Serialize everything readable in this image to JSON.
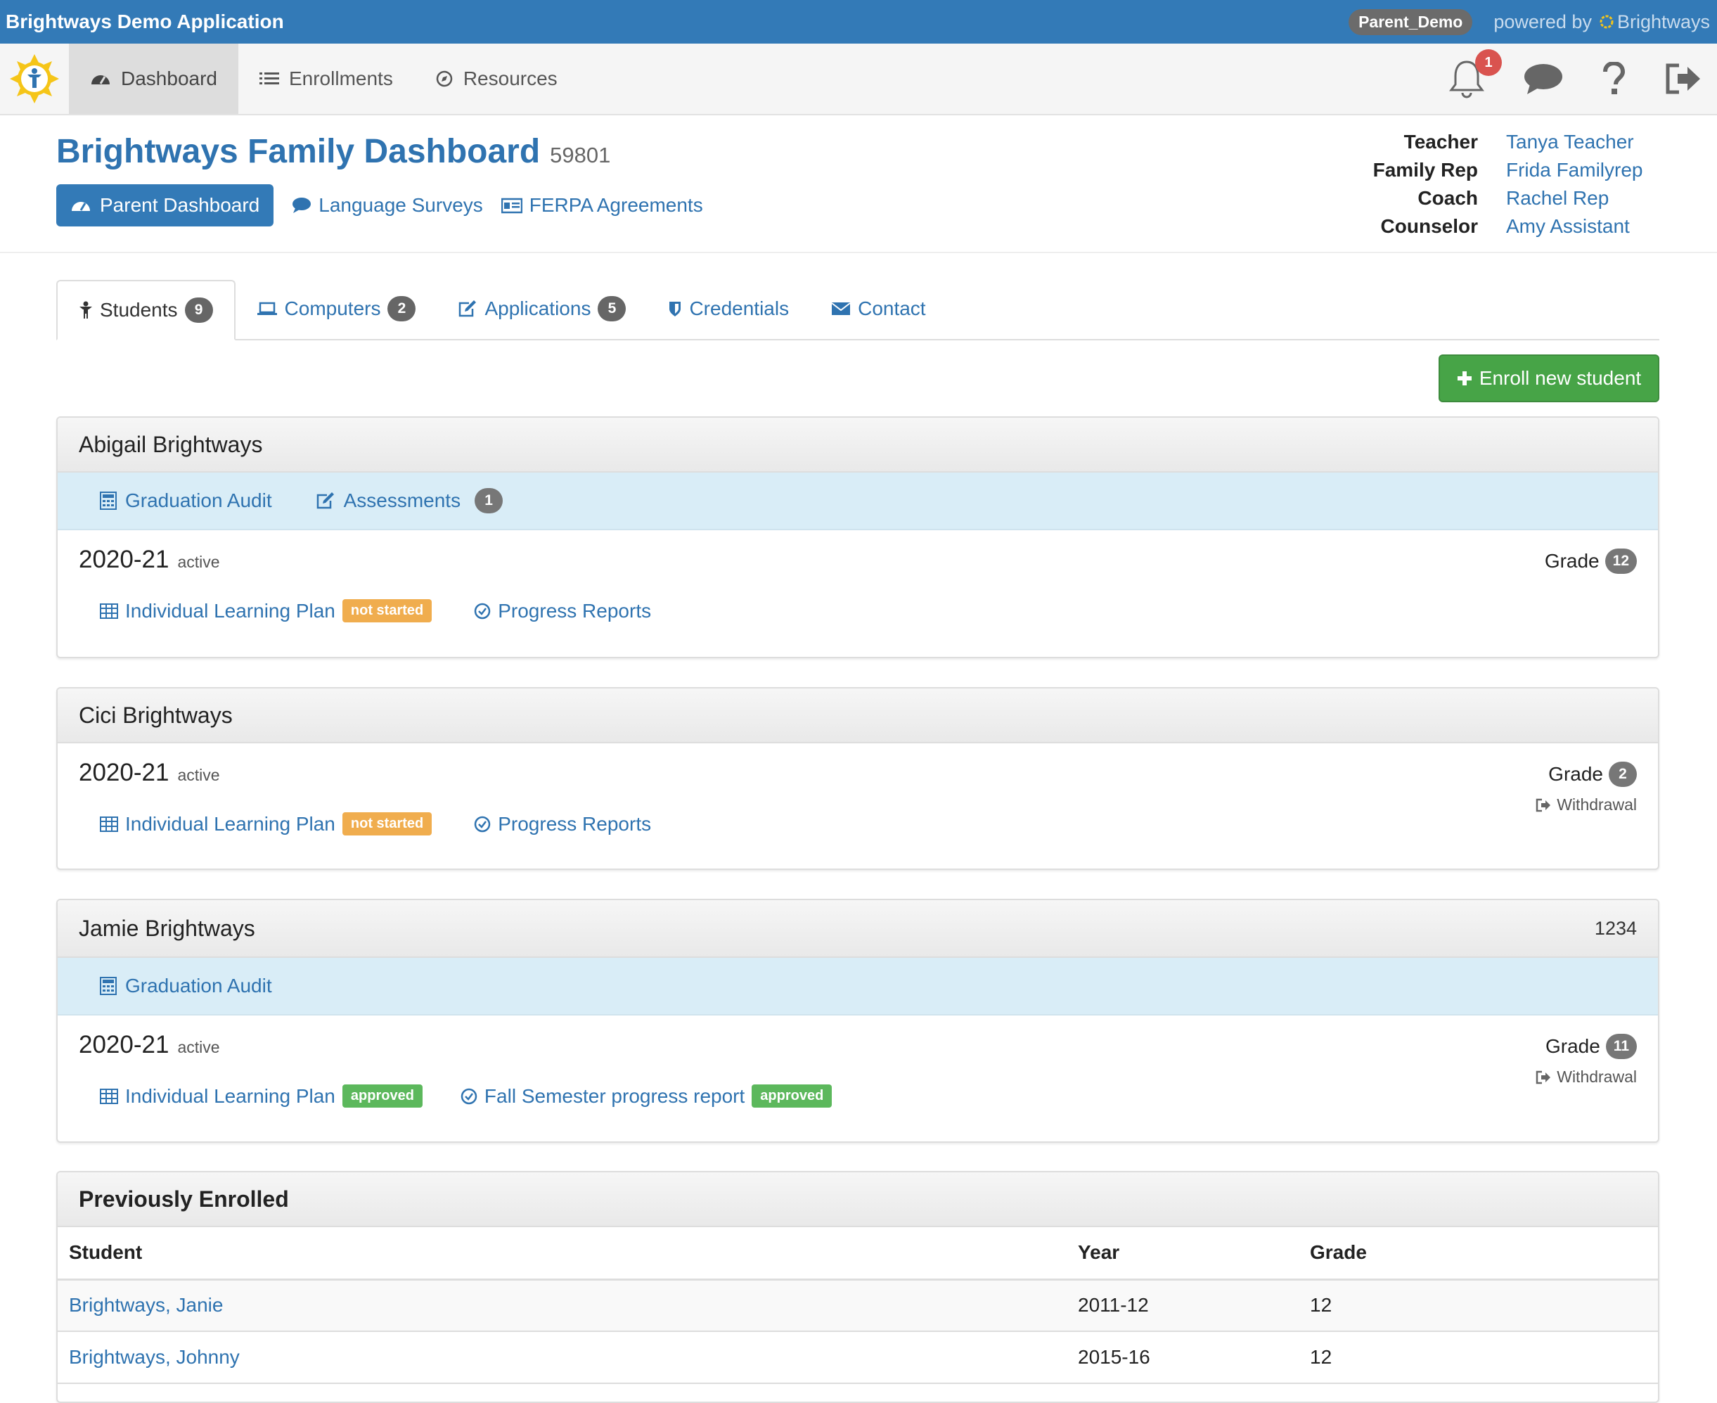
{
  "topbar": {
    "app_title": "Brightways Demo Application",
    "user": "Parent_Demo",
    "powered_by": "powered by",
    "brand": "Brightways"
  },
  "nav": {
    "items": [
      {
        "label": "Dashboard",
        "icon": "dashboard-icon",
        "active": true
      },
      {
        "label": "Enrollments",
        "icon": "list-icon"
      },
      {
        "label": "Resources",
        "icon": "compass-icon"
      }
    ],
    "notification_count": "1"
  },
  "header": {
    "title": "Brightways Family Dashboard",
    "family_id": "59801",
    "links": {
      "parent_dashboard": "Parent Dashboard",
      "language_surveys": "Language Surveys",
      "ferpa": "FERPA Agreements"
    },
    "staff": [
      {
        "role": "Teacher",
        "name": "Tanya Teacher"
      },
      {
        "role": "Family Rep",
        "name": "Frida Familyrep"
      },
      {
        "role": "Coach",
        "name": "Rachel Rep"
      },
      {
        "role": "Counselor",
        "name": "Amy Assistant"
      }
    ]
  },
  "tabs": [
    {
      "label": "Students",
      "count": "9",
      "active": true
    },
    {
      "label": "Computers",
      "count": "2"
    },
    {
      "label": "Applications",
      "count": "5"
    },
    {
      "label": "Credentials"
    },
    {
      "label": "Contact"
    }
  ],
  "enroll_button": "Enroll new student",
  "students": [
    {
      "name": "Abigail Brightways",
      "strip": {
        "graduation_audit": "Graduation Audit",
        "assessments": "Assessments",
        "assessments_count": "1"
      },
      "year": "2020-21",
      "status": "active",
      "grade_label": "Grade",
      "grade": "12",
      "ilp_label": "Individual Learning Plan",
      "ilp_status": "not started",
      "report_label": "Progress Reports"
    },
    {
      "name": "Cici Brightways",
      "year": "2020-21",
      "status": "active",
      "grade_label": "Grade",
      "grade": "2",
      "withdrawal": "Withdrawal",
      "ilp_label": "Individual Learning Plan",
      "ilp_status": "not started",
      "report_label": "Progress Reports"
    },
    {
      "name": "Jamie Brightways",
      "student_id": "1234",
      "strip": {
        "graduation_audit": "Graduation Audit"
      },
      "year": "2020-21",
      "status": "active",
      "grade_label": "Grade",
      "grade": "11",
      "withdrawal": "Withdrawal",
      "ilp_label": "Individual Learning Plan",
      "ilp_status": "approved",
      "report_label": "Fall Semester progress report",
      "report_status": "approved"
    }
  ],
  "previous": {
    "title": "Previously Enrolled",
    "columns": [
      "Student",
      "Year",
      "Grade"
    ],
    "rows": [
      {
        "student": "Brightways, Janie",
        "year": "2011-12",
        "grade": "12"
      },
      {
        "student": "Brightways, Johnny",
        "year": "2015-16",
        "grade": "12"
      }
    ]
  },
  "colors": {
    "topbar": "#337ab7",
    "link": "#2f73b0",
    "success": "#47a447",
    "warning": "#f0ad4e",
    "info_strip": "#d9edf7",
    "alert": "#d9534f"
  }
}
